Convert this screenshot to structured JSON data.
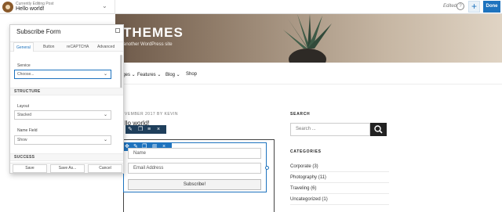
{
  "topbar": {
    "editing_label": "Currently Editing Post",
    "page_name": "Hello world!",
    "edited_label": "Edited",
    "done_label": "Done",
    "accent": "#1e73be"
  },
  "site": {
    "title": "THEMES",
    "tagline": "another WordPress site",
    "nav": [
      "Pages",
      "Features",
      "Blog",
      "Shop"
    ],
    "post_meta": "VEMBER 2017 BY KEVIN",
    "post_title": "llo world!"
  },
  "subscribe_module": {
    "name_placeholder": "Name",
    "email_placeholder": "Email Address",
    "submit_label": "Subscribe!"
  },
  "sidebar": {
    "search_heading": "SEARCH",
    "search_placeholder": "Search ...",
    "categories_heading": "CATEGORIES",
    "categories": [
      "Corporate (3)",
      "Photography (11)",
      "Traveling (6)",
      "Uncategorized (1)"
    ]
  },
  "panel": {
    "title": "Subscribe Form",
    "tabs": [
      "General",
      "Button",
      "reCAPTCHA",
      "Advanced"
    ],
    "service_label": "Service",
    "service_value": "Choose...",
    "structure_heading": "STRUCTURE",
    "layout_label": "Layout",
    "layout_value": "Stacked",
    "name_field_label": "Name Field",
    "name_field_value": "Show",
    "success_heading": "SUCCESS",
    "footer_buttons": [
      "Save",
      "Save As...",
      "Cancel"
    ]
  }
}
